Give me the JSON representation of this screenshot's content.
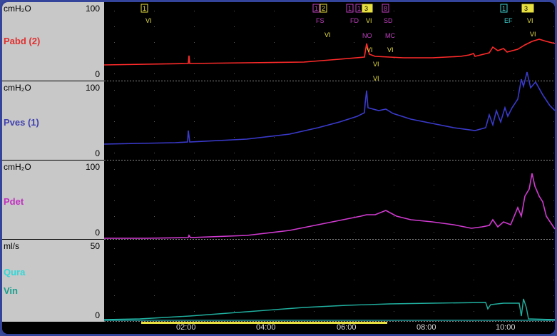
{
  "channels": [
    {
      "unit": "cmH2O",
      "unit_display": "cmH₂O",
      "max": "100",
      "min": "0",
      "name": "Pabd (2)",
      "color": "#ff2a2a"
    },
    {
      "unit": "cmH2O",
      "unit_display": "cmH₂O",
      "max": "100",
      "min": "0",
      "name": "Pves (1)",
      "color": "#3a3acc"
    },
    {
      "unit": "cmH2O",
      "unit_display": "cmH₂O",
      "max": "100",
      "min": "0",
      "name": "Pdet",
      "color": "#d03ad0"
    },
    {
      "unit": "ml/s",
      "unit_display": "ml/s",
      "max": "50",
      "min": "0",
      "name": "Qura",
      "color": "#30d8d8",
      "name2": "Vin",
      "color2": "#20a898"
    }
  ],
  "time_ticks": [
    "02:00",
    "04:00",
    "06:00",
    "08:00",
    "10:00"
  ],
  "markers": [
    {
      "num": "1",
      "label": "VI",
      "color": "#e8e040"
    },
    {
      "num": "1",
      "label": "",
      "color": "#c040c0"
    },
    {
      "num": "2",
      "label": "FS",
      "color": "#e8e040"
    },
    {
      "num": "1",
      "label": "FD",
      "color": "#c040c0"
    },
    {
      "num": "1",
      "label": "",
      "color": "#c040c0"
    },
    {
      "num": "3",
      "label": "VI",
      "color": "#e8e040"
    },
    {
      "num": "8",
      "label": "SD",
      "color": "#c040c0"
    },
    {
      "num": "1",
      "label": "EF",
      "color": "#40d0d0"
    },
    {
      "num": "3",
      "label": "VI",
      "color": "#e8e040"
    }
  ],
  "annotations": [
    "VI",
    "NO",
    "MC",
    "VI",
    "VI",
    "VI",
    "VI",
    "VI"
  ]
}
